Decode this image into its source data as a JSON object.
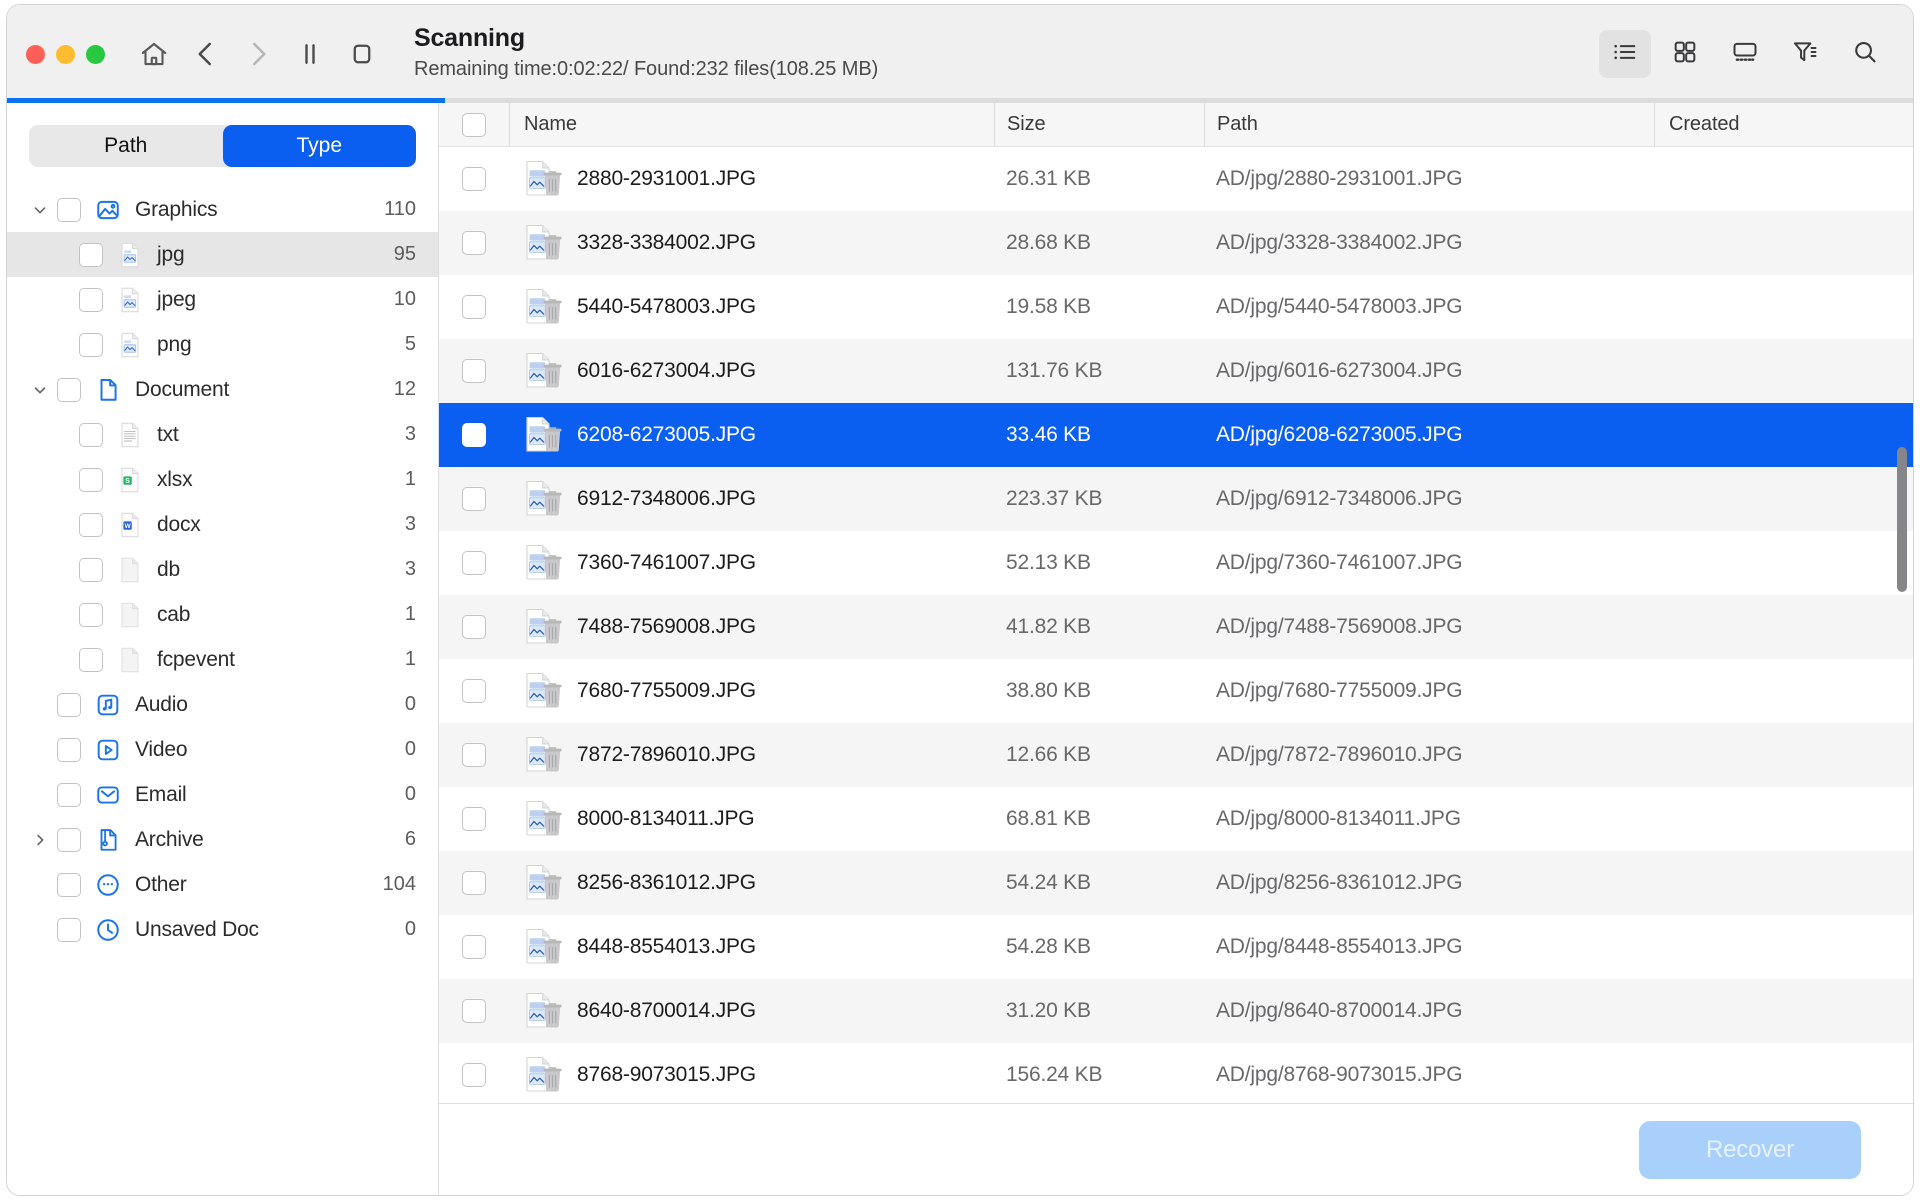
{
  "window": {
    "traffic_lights": [
      "close",
      "minimize",
      "maximize"
    ],
    "colors": {
      "accent_blue": "#0a5ff0",
      "progress_blue": "#0a72ef",
      "selected_row": "#0a5ff0",
      "disabled_button": "#a9d0fb"
    }
  },
  "header": {
    "title": "Scanning",
    "subtitle": "Remaining time:0:02:22/ Found:232 files(108.25 MB)",
    "nav_icons": [
      {
        "name": "home-icon"
      },
      {
        "name": "back-icon"
      },
      {
        "name": "forward-icon"
      },
      {
        "name": "pause-icon"
      },
      {
        "name": "stop-icon"
      }
    ],
    "toolbar_icons": [
      {
        "name": "list-view-icon",
        "active": true
      },
      {
        "name": "grid-view-icon",
        "active": false
      },
      {
        "name": "preview-view-icon",
        "active": false
      },
      {
        "name": "filter-icon",
        "active": false
      },
      {
        "name": "search-icon",
        "active": false
      }
    ],
    "progress_percent": 23
  },
  "sidebar": {
    "segmented": {
      "options": [
        "Path",
        "Type"
      ],
      "path_label": "Path",
      "type_label": "Type",
      "selected": "Type"
    },
    "tree": [
      {
        "label": "Graphics",
        "count": "110",
        "level": 0,
        "twisty": "down",
        "icon": "image-icon",
        "selected": false
      },
      {
        "label": "jpg",
        "count": "95",
        "level": 1,
        "twisty": "none",
        "icon": "jpg-file-icon",
        "selected": true
      },
      {
        "label": "jpeg",
        "count": "10",
        "level": 1,
        "twisty": "none",
        "icon": "jpg-file-icon",
        "selected": false
      },
      {
        "label": "png",
        "count": "5",
        "level": 1,
        "twisty": "none",
        "icon": "jpg-file-icon",
        "selected": false
      },
      {
        "label": "Document",
        "count": "12",
        "level": 0,
        "twisty": "down",
        "icon": "document-icon",
        "selected": false
      },
      {
        "label": "txt",
        "count": "3",
        "level": 1,
        "twisty": "none",
        "icon": "txt-file-icon",
        "selected": false
      },
      {
        "label": "xlsx",
        "count": "1",
        "level": 1,
        "twisty": "none",
        "icon": "xlsx-file-icon",
        "selected": false
      },
      {
        "label": "docx",
        "count": "3",
        "level": 1,
        "twisty": "none",
        "icon": "docx-file-icon",
        "selected": false
      },
      {
        "label": "db",
        "count": "3",
        "level": 1,
        "twisty": "none",
        "icon": "blank-file-icon",
        "selected": false
      },
      {
        "label": "cab",
        "count": "1",
        "level": 1,
        "twisty": "none",
        "icon": "blank-file-icon",
        "selected": false
      },
      {
        "label": "fcpevent",
        "count": "1",
        "level": 1,
        "twisty": "none",
        "icon": "blank-file-icon",
        "selected": false
      },
      {
        "label": "Audio",
        "count": "0",
        "level": 0,
        "twisty": "none",
        "icon": "audio-icon",
        "selected": false
      },
      {
        "label": "Video",
        "count": "0",
        "level": 0,
        "twisty": "none",
        "icon": "video-icon",
        "selected": false
      },
      {
        "label": "Email",
        "count": "0",
        "level": 0,
        "twisty": "none",
        "icon": "email-icon",
        "selected": false
      },
      {
        "label": "Archive",
        "count": "6",
        "level": 0,
        "twisty": "right",
        "icon": "archive-icon",
        "selected": false
      },
      {
        "label": "Other",
        "count": "104",
        "level": 0,
        "twisty": "none",
        "icon": "other-icon",
        "selected": false
      },
      {
        "label": "Unsaved Doc",
        "count": "0",
        "level": 0,
        "twisty": "none",
        "icon": "clock-icon",
        "selected": false
      }
    ]
  },
  "table": {
    "columns": [
      "Name",
      "Size",
      "Path",
      "Created"
    ],
    "headers": {
      "name": "Name",
      "size": "Size",
      "path": "Path",
      "created": "Created"
    },
    "rows": [
      {
        "name": "2880-2931001.JPG",
        "size": "26.31 KB",
        "path": "AD/jpg/2880-2931001.JPG",
        "created": "",
        "selected": false
      },
      {
        "name": "3328-3384002.JPG",
        "size": "28.68 KB",
        "path": "AD/jpg/3328-3384002.JPG",
        "created": "",
        "selected": false
      },
      {
        "name": "5440-5478003.JPG",
        "size": "19.58 KB",
        "path": "AD/jpg/5440-5478003.JPG",
        "created": "",
        "selected": false
      },
      {
        "name": "6016-6273004.JPG",
        "size": "131.76 KB",
        "path": "AD/jpg/6016-6273004.JPG",
        "created": "",
        "selected": false
      },
      {
        "name": "6208-6273005.JPG",
        "size": "33.46 KB",
        "path": "AD/jpg/6208-6273005.JPG",
        "created": "",
        "selected": true
      },
      {
        "name": "6912-7348006.JPG",
        "size": "223.37 KB",
        "path": "AD/jpg/6912-7348006.JPG",
        "created": "",
        "selected": false
      },
      {
        "name": "7360-7461007.JPG",
        "size": "52.13 KB",
        "path": "AD/jpg/7360-7461007.JPG",
        "created": "",
        "selected": false
      },
      {
        "name": "7488-7569008.JPG",
        "size": "41.82 KB",
        "path": "AD/jpg/7488-7569008.JPG",
        "created": "",
        "selected": false
      },
      {
        "name": "7680-7755009.JPG",
        "size": "38.80 KB",
        "path": "AD/jpg/7680-7755009.JPG",
        "created": "",
        "selected": false
      },
      {
        "name": "7872-7896010.JPG",
        "size": "12.66 KB",
        "path": "AD/jpg/7872-7896010.JPG",
        "created": "",
        "selected": false
      },
      {
        "name": "8000-8134011.JPG",
        "size": "68.81 KB",
        "path": "AD/jpg/8000-8134011.JPG",
        "created": "",
        "selected": false
      },
      {
        "name": "8256-8361012.JPG",
        "size": "54.24 KB",
        "path": "AD/jpg/8256-8361012.JPG",
        "created": "",
        "selected": false
      },
      {
        "name": "8448-8554013.JPG",
        "size": "54.28 KB",
        "path": "AD/jpg/8448-8554013.JPG",
        "created": "",
        "selected": false
      },
      {
        "name": "8640-8700014.JPG",
        "size": "31.20 KB",
        "path": "AD/jpg/8640-8700014.JPG",
        "created": "",
        "selected": false
      },
      {
        "name": "8768-9073015.JPG",
        "size": "156.24 KB",
        "path": "AD/jpg/8768-9073015.JPG",
        "created": "",
        "selected": false
      }
    ]
  },
  "footer": {
    "recover_label": "Recover",
    "recover_enabled": false
  }
}
